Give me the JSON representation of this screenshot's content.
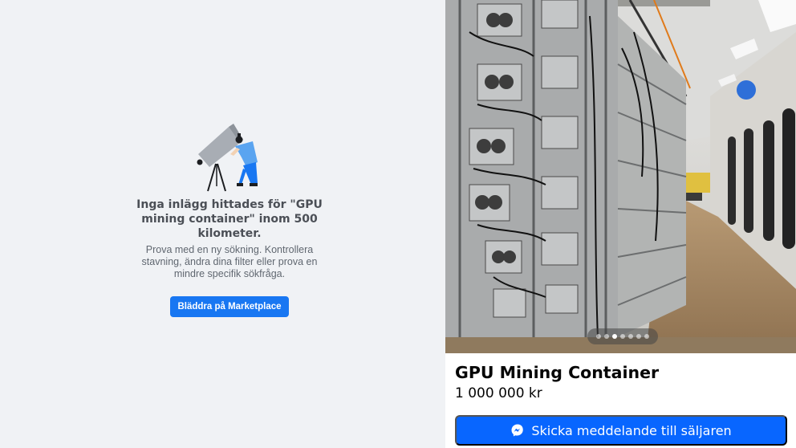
{
  "empty_state": {
    "illustration_icon": "telescope-person-illustration",
    "title": "Inga inlägg hittades för \"GPU mining container\" inom 500 kilometer.",
    "subtitle": "Prova med en ny sökning. Kontrollera stavning, ändra dina filter eller prova en mindre specifik sökfråga.",
    "browse_button": "Bläddra på Marketplace"
  },
  "listing": {
    "image_alt_icon": "gpu-mining-rack-photo",
    "carousel": {
      "total": 7,
      "active_index": 2
    },
    "title": "GPU Mining Container",
    "price": "1 000 000 kr",
    "message_button": "Skicka meddelande till säljaren",
    "message_icon": "messenger-icon"
  },
  "colors": {
    "page_bg": "#f0f2f5",
    "primary": "#1877f2",
    "message_button": "#0866ff"
  }
}
